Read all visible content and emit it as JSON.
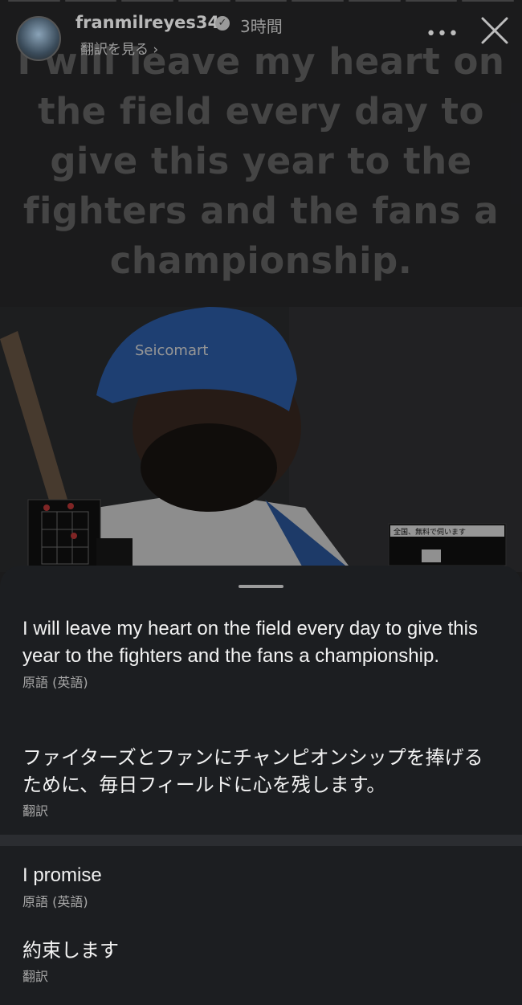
{
  "story": {
    "username": "franmilreyes34",
    "time": "3時間",
    "translate_link": "翻訳を見る ›",
    "more_label": "•••",
    "text": "I will leave my heart on the field every day to give this year to the fighters and the fans a championship.",
    "photo_logo": "Seicomart",
    "tv_text": "全国、無料で伺います"
  },
  "sheet": {
    "items": [
      {
        "text": "I will leave my heart on the field every day to give this year to the fighters and the fans a championship.",
        "caption": "原語 (英語)"
      },
      {
        "text": "ファイターズとファンにチャンピオンシップを捧げるために、毎日フィールドに心を残します。",
        "caption": "翻訳"
      },
      {
        "text": "I promise",
        "caption": "原語 (英語)"
      },
      {
        "text": "約束します",
        "caption": "翻訳"
      }
    ]
  }
}
